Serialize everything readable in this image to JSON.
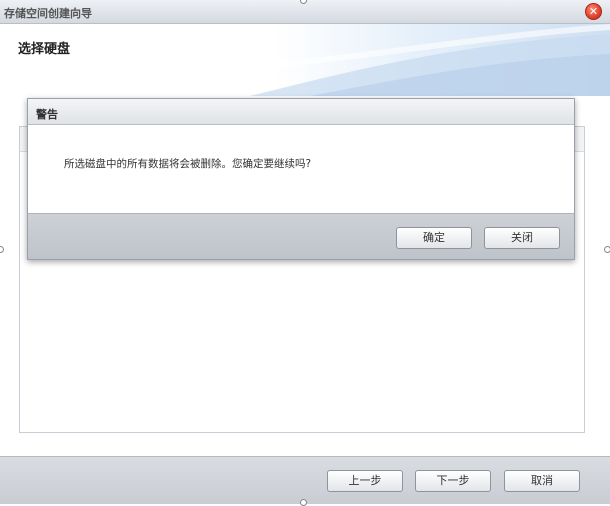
{
  "window": {
    "title": "存储空间创建向导",
    "close_symbol": "✕"
  },
  "header": {
    "page_title": "选择硬盘"
  },
  "footer": {
    "prev_label": "上一步",
    "next_label": "下一步",
    "cancel_label": "取消"
  },
  "dialog": {
    "title": "警告",
    "message": "所选磁盘中的所有数据将会被删除。您确定要继续吗?",
    "ok_label": "确定",
    "close_label": "关闭"
  },
  "colors": {
    "close_button": "#e2402a",
    "header_gradient_end": "#cfe0f2",
    "footer_bg": "#c9cdd3"
  },
  "icons": {
    "close": "close-icon"
  }
}
